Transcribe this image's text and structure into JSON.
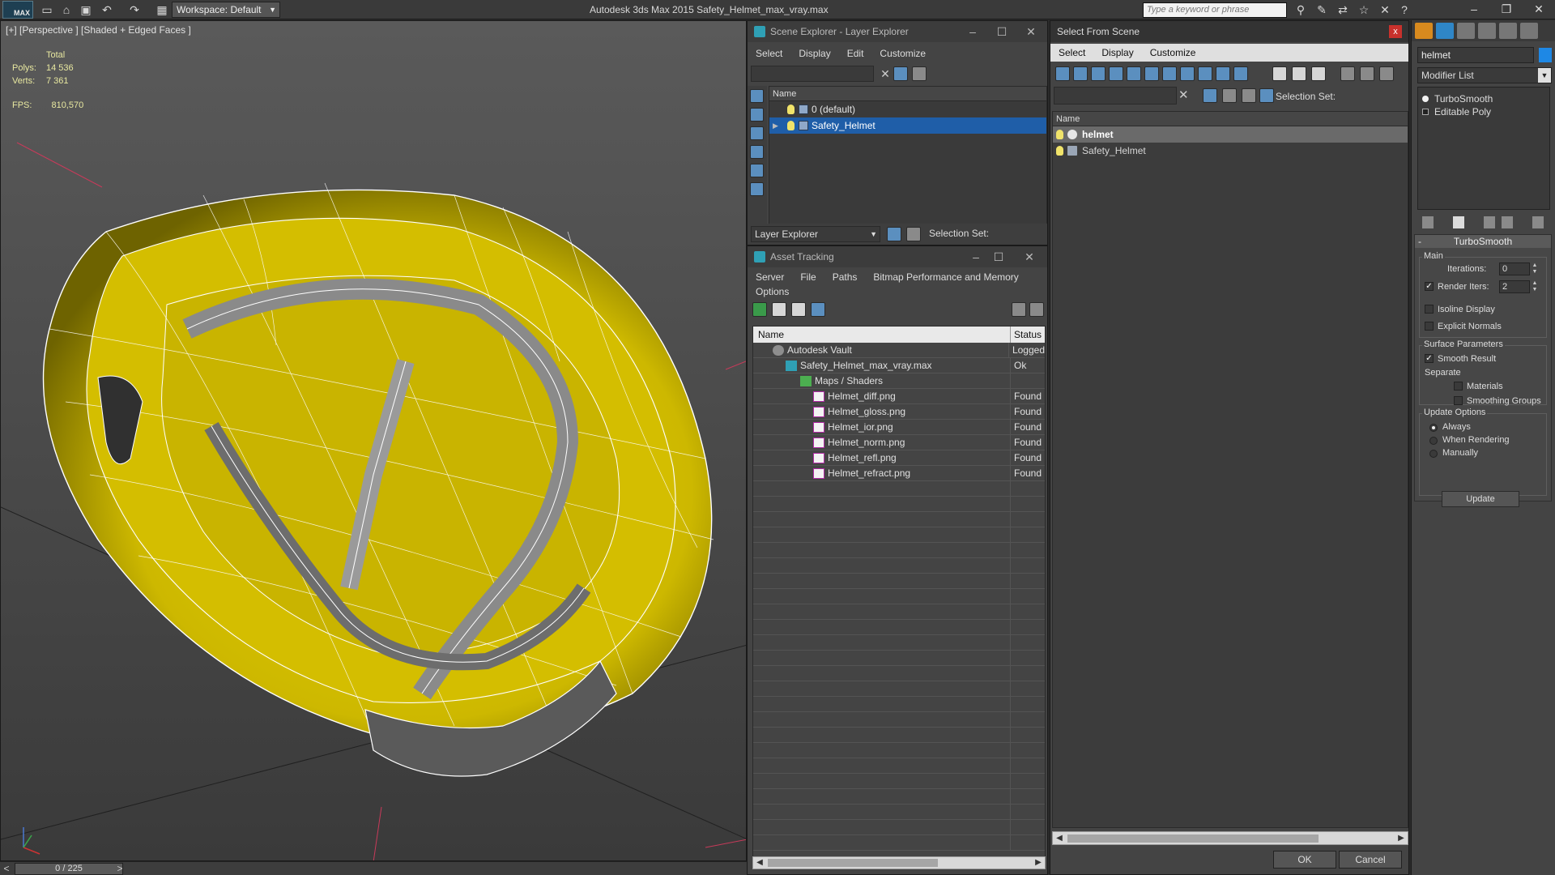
{
  "titlebar": {
    "app_logo": "MAX",
    "workspace": "Workspace: Default",
    "title": "Autodesk 3ds Max  2015    Safety_Helmet_max_vray.max",
    "search_placeholder": "Type a keyword or phrase"
  },
  "viewport": {
    "label": "[+] [Perspective ] [Shaded + Edged Faces ]",
    "stats_header": "Total",
    "polys_label": "Polys:",
    "polys_value": "14 536",
    "verts_label": "Verts:",
    "verts_value": "7 361",
    "fps_label": "FPS:",
    "fps_value": "810,570",
    "wire_color": "#ffffff",
    "shell_color": "#d9c400"
  },
  "timeline": {
    "frame": "0 / 225",
    "prev": "<",
    "next": ">"
  },
  "scene_explorer": {
    "title": "Scene Explorer - Layer Explorer",
    "menu": [
      "Select",
      "Display",
      "Edit",
      "Customize"
    ],
    "column_name": "Name",
    "rows": [
      {
        "name": "0 (default)",
        "selected": false
      },
      {
        "name": "Safety_Helmet",
        "selected": true
      }
    ],
    "layer_dropdown": "Layer Explorer",
    "selection_set_label": "Selection Set:"
  },
  "asset_tracking": {
    "title": "Asset Tracking",
    "menu_row1": [
      "Server",
      "File",
      "Paths",
      "Bitmap Performance and Memory"
    ],
    "menu_row2": [
      "Options"
    ],
    "col_name": "Name",
    "col_status": "Status",
    "rows": [
      {
        "name": "Autodesk Vault",
        "status": "Logged",
        "indent": 1,
        "icon": "vault"
      },
      {
        "name": "Safety_Helmet_max_vray.max",
        "status": "Ok",
        "indent": 2,
        "icon": "max"
      },
      {
        "name": "Maps / Shaders",
        "status": "",
        "indent": 3,
        "icon": "maps"
      },
      {
        "name": "Helmet_diff.png",
        "status": "Found",
        "indent": 4,
        "icon": "png"
      },
      {
        "name": "Helmet_gloss.png",
        "status": "Found",
        "indent": 4,
        "icon": "png"
      },
      {
        "name": "Helmet_ior.png",
        "status": "Found",
        "indent": 4,
        "icon": "png"
      },
      {
        "name": "Helmet_norm.png",
        "status": "Found",
        "indent": 4,
        "icon": "png"
      },
      {
        "name": "Helmet_refl.png",
        "status": "Found",
        "indent": 4,
        "icon": "png"
      },
      {
        "name": "Helmet_refract.png",
        "status": "Found",
        "indent": 4,
        "icon": "png"
      }
    ]
  },
  "select_from_scene": {
    "title": "Select From Scene",
    "close": "x",
    "menu": [
      "Select",
      "Display",
      "Customize"
    ],
    "selection_set_label": "Selection Set:",
    "column_name": "Name",
    "rows": [
      {
        "name": "helmet",
        "selected": true,
        "icon": "sphere"
      },
      {
        "name": "Safety_Helmet",
        "selected": false,
        "icon": "layer"
      }
    ],
    "ok": "OK",
    "cancel": "Cancel"
  },
  "command_panel": {
    "object_name": "helmet",
    "object_color": "#1e88e5",
    "modifier_list": "Modifier List",
    "stack": [
      "TurboSmooth",
      "Editable Poly"
    ],
    "rollout_title": "TurboSmooth",
    "main_label": "Main",
    "iterations_label": "Iterations:",
    "iterations_value": "0",
    "render_iters_label": "Render Iters:",
    "render_iters_value": "2",
    "render_iters_checked": true,
    "isoline_label": "Isoline Display",
    "explicit_normals_label": "Explicit Normals",
    "surface_label": "Surface Parameters",
    "smooth_result_label": "Smooth Result",
    "separate_label": "Separate",
    "materials_label": "Materials",
    "smoothing_groups_label": "Smoothing Groups",
    "update_options_label": "Update Options",
    "always_label": "Always",
    "when_rendering_label": "When Rendering",
    "manually_label": "Manually",
    "update_button": "Update"
  }
}
